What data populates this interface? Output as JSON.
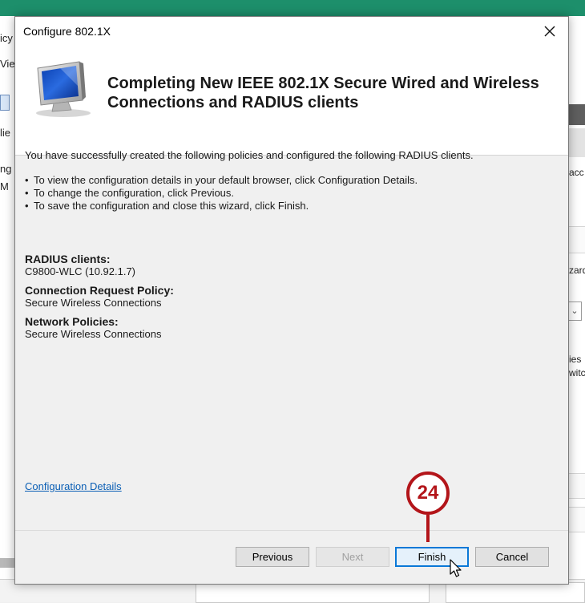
{
  "background": {
    "topbar_color": "#1d8f6b",
    "left_fragments": [
      "icy",
      "Vie",
      "lie",
      "ng",
      "M"
    ],
    "right_fragments": [
      "acc",
      "zard",
      "ies",
      "witc"
    ],
    "dropdown_glyph": "⌄"
  },
  "dialog": {
    "title": "Configure 802.1X",
    "close_glyph": "✕",
    "header": {
      "title": "Completing New IEEE 802.1X Secure Wired and Wireless Connections and RADIUS clients",
      "icon": "computer-monitor-icon"
    },
    "intro": "You have successfully created the following policies and configured the following RADIUS clients.",
    "bullets": [
      "To view the configuration details in your default browser, click Configuration Details.",
      "To change the configuration, click Previous.",
      "To save the configuration and close this wizard, click Finish."
    ],
    "bullet_glyph": "•",
    "radius_clients": {
      "label": "RADIUS clients:",
      "value": "C9800-WLC (10.92.1.7)"
    },
    "connection_request_policy": {
      "label": "Connection Request Policy:",
      "value": "Secure Wireless Connections"
    },
    "network_policies": {
      "label": "Network Policies:",
      "value": "Secure Wireless Connections"
    },
    "config_details_link": "Configuration Details",
    "buttons": {
      "previous": "Previous",
      "next": "Next",
      "finish": "Finish",
      "cancel": "Cancel"
    }
  },
  "callout": {
    "number": "24",
    "color": "#b3151a"
  },
  "colors": {
    "link": "#0b5fb5",
    "primary_border": "#0a78d7"
  }
}
